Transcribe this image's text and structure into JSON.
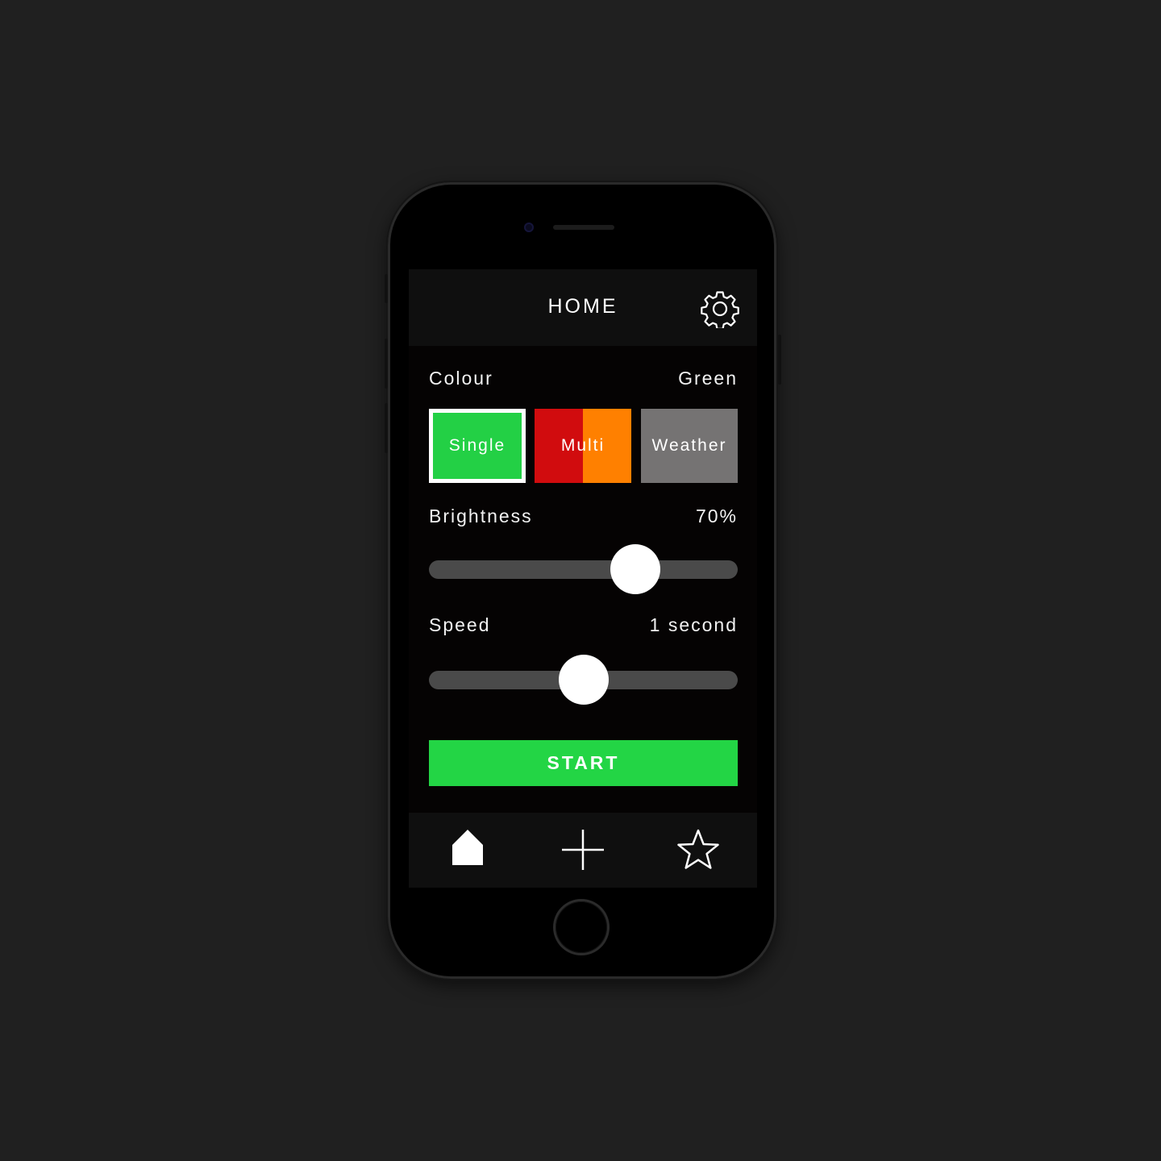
{
  "header": {
    "title": "HOME",
    "settings_icon": "gear-icon"
  },
  "colour": {
    "label": "Colour",
    "value": "Green",
    "modes": [
      {
        "label": "Single",
        "selected": true,
        "color": "#23d045"
      },
      {
        "label": "Multi",
        "colors": [
          "#d10c0e",
          "#ff8000"
        ]
      },
      {
        "label": "Weather",
        "color": "#757373"
      }
    ]
  },
  "brightness": {
    "label": "Brightness",
    "value": "70%",
    "level": 0.7
  },
  "speed": {
    "label": "Speed",
    "value": "1 second",
    "level": 0.5
  },
  "start_button": {
    "label": "START",
    "color": "#23d545"
  },
  "tabs": [
    {
      "icon": "home-icon",
      "active": true
    },
    {
      "icon": "plus-icon"
    },
    {
      "icon": "star-icon"
    }
  ]
}
